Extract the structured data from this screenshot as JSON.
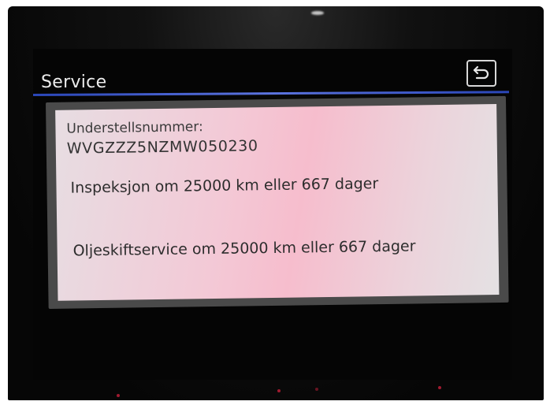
{
  "header": {
    "title": "Service",
    "back_icon": "return-arrow-icon"
  },
  "service_info": {
    "vin_label": "Understellsnummer:",
    "vin_value": "WVGZZZ5NZMW050230",
    "inspection_text": "Inspeksjon om 25000 km eller 667 dager",
    "oil_service_text": "Oljeskiftservice om 25000 km eller 667 dager"
  },
  "colors": {
    "accent_rule": "#3f5bd1",
    "panel_bg": "#f1c9d5",
    "screen_bg": "#050505",
    "title_text": "#ececec"
  }
}
